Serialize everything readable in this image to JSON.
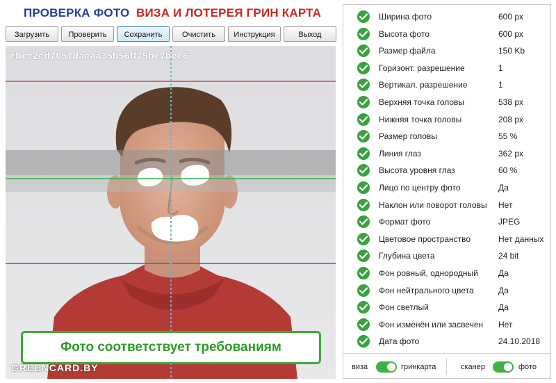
{
  "header": {
    "title_main": "ПРОВЕРКА ФОТО",
    "title_sub": "ВИЗА И ЛОТЕРЕЯ ГРИН КАРТА"
  },
  "toolbar": {
    "buttons": [
      {
        "label": "Загрузить"
      },
      {
        "label": "Проверить"
      },
      {
        "label": "Сохранить"
      },
      {
        "label": "Очистить"
      },
      {
        "label": "Инструкция"
      },
      {
        "label": "Выход"
      }
    ]
  },
  "photo": {
    "file_id": "cbec2ed7057daeaa35b56ff75be7bec6",
    "status_message": "Фото соответствует требованиям",
    "watermark": "GREENCARD.BY"
  },
  "checks": [
    {
      "label": "Ширина фото",
      "value": "600 px"
    },
    {
      "label": "Высота фото",
      "value": "600 px"
    },
    {
      "label": "Размер файла",
      "value": "150 Kb"
    },
    {
      "label": "Горизонт. разрешение",
      "value": "1"
    },
    {
      "label": "Вертикал. разрешение",
      "value": "1"
    },
    {
      "label": "Верхняя точка головы",
      "value": "538 px"
    },
    {
      "label": "Нижняя точка головы",
      "value": "208 px"
    },
    {
      "label": "Размер головы",
      "value": "55 %"
    },
    {
      "label": "Линия глаз",
      "value": "362 px"
    },
    {
      "label": "Высота уровня глаз",
      "value": "60 %"
    },
    {
      "label": "Лицо по центру фото",
      "value": "Да"
    },
    {
      "label": "Наклон или поворот головы",
      "value": "Нет"
    },
    {
      "label": "Формат фото",
      "value": "JPEG"
    },
    {
      "label": "Цветовое пространство",
      "value": "Нет данных"
    },
    {
      "label": "Глубина цвета",
      "value": "24 bit"
    },
    {
      "label": "Фон ровный, однородный",
      "value": "Да"
    },
    {
      "label": "Фон нейтрального цвета",
      "value": "Да"
    },
    {
      "label": "Фон светлый",
      "value": "Да"
    },
    {
      "label": "Фон изменён или засвечен",
      "value": "Нет"
    },
    {
      "label": "Дата фото",
      "value": "24.10.2018"
    }
  ],
  "footer": {
    "left_label": "виза",
    "left_right_label": "гринкарта",
    "right_label": "сканер",
    "right_right_label": "фото"
  },
  "colors": {
    "title_main": "#1f3f9a",
    "title_sub": "#c8261f",
    "check_green": "#39a23f",
    "toggle_green": "#3fb044",
    "line_red": "#e03a3a",
    "line_green": "#2fb54a",
    "line_blue": "#3a5fd8"
  },
  "icons": {
    "check": "check-circle-icon"
  }
}
